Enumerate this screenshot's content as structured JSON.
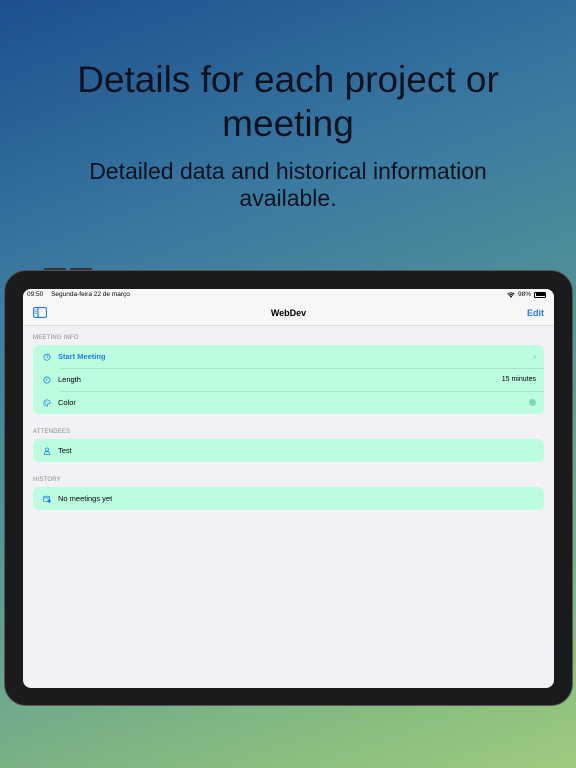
{
  "marketing": {
    "headline": "Details for each project or meeting",
    "subline": "Detailed data and historical information available."
  },
  "status_bar": {
    "time": "09:50",
    "date": "Segunda-feira 22 de março",
    "battery": "98%"
  },
  "nav": {
    "title": "WebDev",
    "edit_label": "Edit"
  },
  "sections": {
    "meeting_info": {
      "header": "MEETING INFO",
      "start_label": "Start Meeting",
      "length_label": "Length",
      "length_value": "15 minutes",
      "color_label": "Color",
      "color_value_hex": "#7bd8b3"
    },
    "attendees": {
      "header": "ATTENDEES",
      "items": [
        "Test"
      ]
    },
    "history": {
      "header": "HISTORY",
      "empty_label": "No meetings yet"
    }
  },
  "colors": {
    "accent": "#1f7ee6",
    "row_bg": "#bcfde0",
    "screen_bg": "#f2f2f6"
  }
}
